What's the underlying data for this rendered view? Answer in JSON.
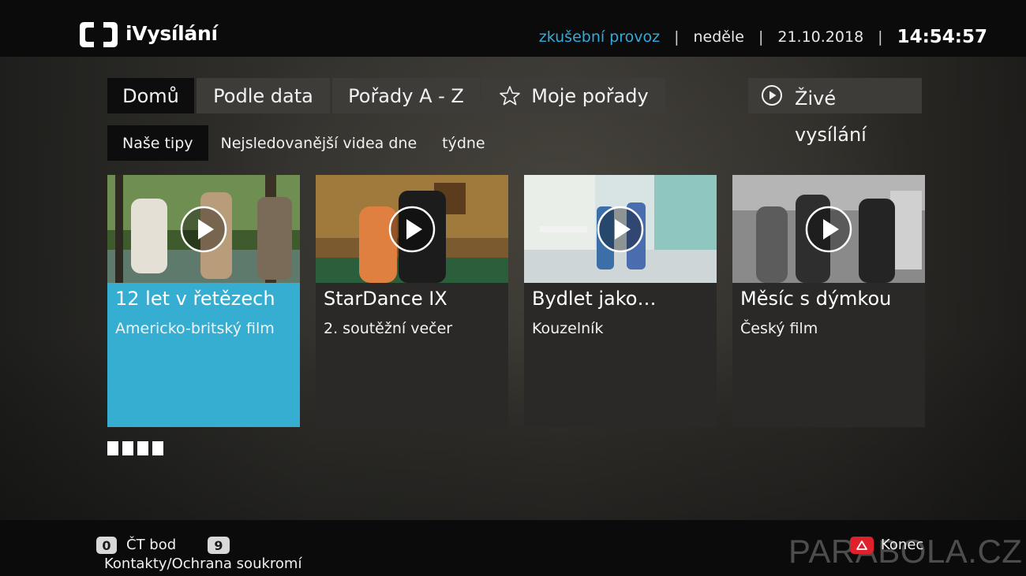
{
  "header": {
    "app_name": "iVysílání",
    "mode": "zkušební provoz",
    "day": "neděle",
    "date": "21.10.2018",
    "time": "14:54:57",
    "separator": "|",
    "accent_color": "#34a9dc"
  },
  "nav": {
    "tabs": [
      {
        "label": "Domů",
        "active": true
      },
      {
        "label": "Podle data",
        "active": false
      },
      {
        "label": "Pořady A - Z",
        "active": false
      },
      {
        "label": "Moje pořady",
        "active": false,
        "icon": "star-icon"
      }
    ],
    "live": {
      "label": "Živé vysílání",
      "icon": "play-icon"
    }
  },
  "subnav": {
    "tabs": [
      {
        "label": "Naše tipy",
        "active": true
      },
      {
        "label": "Nejsledovanější videa dne",
        "active": false
      },
      {
        "label": "týdne",
        "active": false
      }
    ]
  },
  "cards": [
    {
      "title": "12 let v řetězech",
      "subtitle": "Americko-britský film",
      "focused": true,
      "icon": "play-icon"
    },
    {
      "title": "StarDance IX",
      "subtitle": "2. soutěžní večer",
      "focused": false,
      "icon": "play-icon"
    },
    {
      "title": "Bydlet jako…",
      "subtitle": "Kouzelník",
      "focused": false,
      "icon": "play-icon"
    },
    {
      "title": "Měsíc s dýmkou",
      "subtitle": "Český film",
      "focused": false,
      "icon": "play-icon"
    }
  ],
  "focus_color": "#35aed2",
  "pager": {
    "pages": 4
  },
  "footer": {
    "keys": [
      {
        "key": "0",
        "label": "ČT bod"
      },
      {
        "key": "9",
        "label": "Kontakty/Ochrana soukromí"
      },
      {
        "key": "red",
        "label": "Konec",
        "color": "#e0202a"
      }
    ],
    "watermark": "PARABOLA.CZ"
  }
}
